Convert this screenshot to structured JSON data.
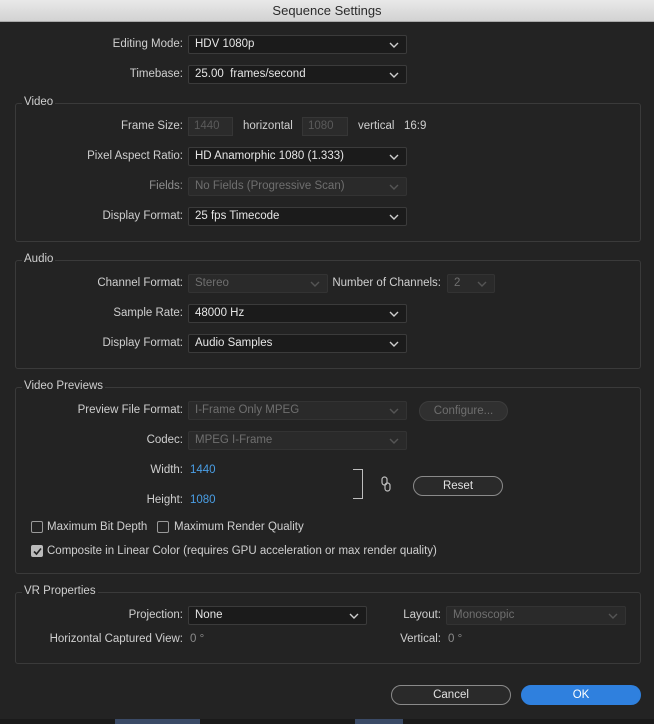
{
  "window": {
    "title": "Sequence Settings"
  },
  "top": {
    "editing_mode": {
      "label": "Editing Mode:",
      "value": "HDV 1080p"
    },
    "timebase": {
      "label": "Timebase:",
      "value": "25.00  frames/second"
    }
  },
  "video": {
    "title": "Video",
    "frame_size": {
      "label": "Frame Size:",
      "width": "1440",
      "horizontal": "horizontal",
      "height": "1080",
      "vertical": "vertical",
      "aspect": "16:9"
    },
    "pixel_aspect": {
      "label": "Pixel Aspect Ratio:",
      "value": "HD Anamorphic 1080 (1.333)"
    },
    "fields": {
      "label": "Fields:",
      "value": "No Fields (Progressive Scan)"
    },
    "display_format": {
      "label": "Display Format:",
      "value": "25 fps Timecode"
    }
  },
  "audio": {
    "title": "Audio",
    "channel_format": {
      "label": "Channel Format:",
      "value": "Stereo"
    },
    "num_channels": {
      "label": "Number of Channels:",
      "value": "2"
    },
    "sample_rate": {
      "label": "Sample Rate:",
      "value": "48000 Hz"
    },
    "display_format": {
      "label": "Display Format:",
      "value": "Audio Samples"
    }
  },
  "video_previews": {
    "title": "Video Previews",
    "file_format": {
      "label": "Preview File Format:",
      "value": "I-Frame Only MPEG"
    },
    "configure_label": "Configure...",
    "codec": {
      "label": "Codec:",
      "value": "MPEG I-Frame"
    },
    "width": {
      "label": "Width:",
      "value": "1440"
    },
    "height": {
      "label": "Height:",
      "value": "1080"
    },
    "reset_label": "Reset",
    "max_bit_depth": {
      "label": "Maximum Bit Depth",
      "checked": false
    },
    "max_render_quality": {
      "label": "Maximum Render Quality",
      "checked": false
    },
    "composite_linear": {
      "label": "Composite in Linear Color (requires GPU acceleration or max render quality)",
      "checked": true
    }
  },
  "vr": {
    "title": "VR Properties",
    "projection": {
      "label": "Projection:",
      "value": "None"
    },
    "layout": {
      "label": "Layout:",
      "value": "Monoscopic"
    },
    "horizontal_view": {
      "label": "Horizontal Captured View:",
      "value": "0 °"
    },
    "vertical": {
      "label": "Vertical:",
      "value": "0 °"
    }
  },
  "buttons": {
    "cancel": "Cancel",
    "ok": "OK"
  },
  "colors": {
    "background": "#232323",
    "accent": "#2f80de",
    "value_blue": "#4a9fe6"
  },
  "icons": [
    "chevron-down-icon",
    "checkmark-icon",
    "link-icon"
  ]
}
